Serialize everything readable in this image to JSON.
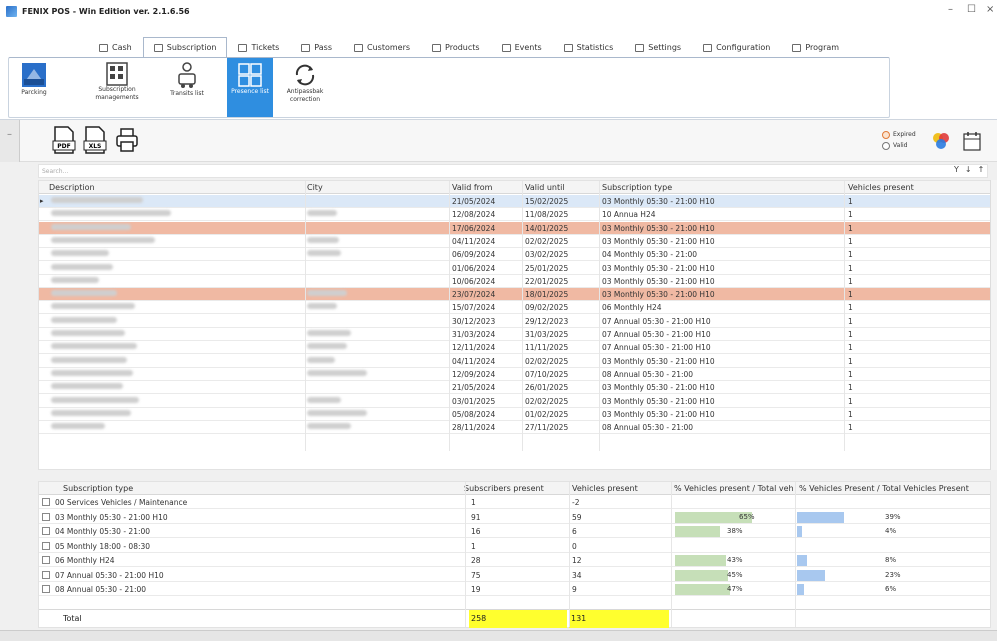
{
  "window": {
    "title": "FENIX POS - Win Edition ver. 2.1.6.56",
    "minimize": "–",
    "maximize": "☐",
    "close": "×"
  },
  "tabs": [
    {
      "label": "Cash",
      "active": false
    },
    {
      "label": "Subscription",
      "active": true
    },
    {
      "label": "Tickets",
      "active": false
    },
    {
      "label": "Pass",
      "active": false
    },
    {
      "label": "Customers",
      "active": false
    },
    {
      "label": "Products",
      "active": false
    },
    {
      "label": "Events",
      "active": false
    },
    {
      "label": "Statistics",
      "active": false
    },
    {
      "label": "Settings",
      "active": false
    },
    {
      "label": "Configuration",
      "active": false
    },
    {
      "label": "Program",
      "active": false
    }
  ],
  "ribbon": {
    "parking": "Parcking",
    "subscription_management": "Subscription managements",
    "transits_list": "Transits list",
    "presence_list": "Presence list",
    "antipassback": "Antipassbak correction"
  },
  "toolbar": {
    "pdf": "PDF",
    "xls": "XLS",
    "expired_label": "Expired",
    "valid_label": "Valid"
  },
  "search": {
    "placeholder": "Search..."
  },
  "grid": {
    "columns": [
      "Description",
      "City",
      "Valid from",
      "Valid until",
      "Subscription type",
      "Vehicles present"
    ],
    "rows": [
      {
        "from": "21/05/2024",
        "until": "15/02/2025",
        "type": "03 Monthly 05:30 - 21:00 H10",
        "vehicles": "1",
        "state": "selected",
        "city": false
      },
      {
        "from": "12/08/2024",
        "until": "11/08/2025",
        "type": "10 Annua H24",
        "vehicles": "1",
        "state": "",
        "city": true
      },
      {
        "from": "17/06/2024",
        "until": "14/01/2025",
        "type": "03 Monthly 05:30 - 21:00 H10",
        "vehicles": "1",
        "state": "expired",
        "city": false
      },
      {
        "from": "04/11/2024",
        "until": "02/02/2025",
        "type": "03 Monthly 05:30 - 21:00 H10",
        "vehicles": "1",
        "state": "",
        "city": true
      },
      {
        "from": "06/09/2024",
        "until": "03/02/2025",
        "type": "04 Monthly 05:30 - 21:00",
        "vehicles": "1",
        "state": "",
        "city": true
      },
      {
        "from": "01/06/2024",
        "until": "25/01/2025",
        "type": "03 Monthly 05:30 - 21:00 H10",
        "vehicles": "1",
        "state": "",
        "city": false
      },
      {
        "from": "10/06/2024",
        "until": "22/01/2025",
        "type": "03 Monthly 05:30 - 21:00 H10",
        "vehicles": "1",
        "state": "",
        "city": false
      },
      {
        "from": "23/07/2024",
        "until": "18/01/2025",
        "type": "03 Monthly 05:30 - 21:00 H10",
        "vehicles": "1",
        "state": "expired",
        "city": true
      },
      {
        "from": "15/07/2024",
        "until": "09/02/2025",
        "type": "06 Monthly H24",
        "vehicles": "1",
        "state": "",
        "city": true
      },
      {
        "from": "30/12/2023",
        "until": "29/12/2023",
        "type": "07 Annual 05:30 - 21:00 H10",
        "vehicles": "1",
        "state": "",
        "city": false
      },
      {
        "from": "31/03/2024",
        "until": "31/03/2025",
        "type": "07 Annual 05:30 - 21:00 H10",
        "vehicles": "1",
        "state": "",
        "city": true
      },
      {
        "from": "12/11/2024",
        "until": "11/11/2025",
        "type": "07 Annual 05:30 - 21:00 H10",
        "vehicles": "1",
        "state": "",
        "city": true
      },
      {
        "from": "04/11/2024",
        "until": "02/02/2025",
        "type": "03 Monthly 05:30 - 21:00 H10",
        "vehicles": "1",
        "state": "",
        "city": true
      },
      {
        "from": "12/09/2024",
        "until": "07/10/2025",
        "type": "08 Annual 05:30 - 21:00",
        "vehicles": "1",
        "state": "",
        "city": true
      },
      {
        "from": "21/05/2024",
        "until": "26/01/2025",
        "type": "03 Monthly 05:30 - 21:00 H10",
        "vehicles": "1",
        "state": "",
        "city": false
      },
      {
        "from": "03/01/2025",
        "until": "02/02/2025",
        "type": "03 Monthly 05:30 - 21:00 H10",
        "vehicles": "1",
        "state": "",
        "city": true
      },
      {
        "from": "05/08/2024",
        "until": "01/02/2025",
        "type": "03 Monthly 05:30 - 21:00 H10",
        "vehicles": "1",
        "state": "",
        "city": true
      },
      {
        "from": "28/11/2024",
        "until": "27/11/2025",
        "type": "08 Annual 05:30 - 21:00",
        "vehicles": "1",
        "state": "",
        "city": true
      }
    ]
  },
  "summary": {
    "columns": [
      "Subscription type",
      "Subscribers present",
      "Vehicles present",
      "% Vehicles present / Total veh",
      "% Vehicles Present / Total Vehicles Present"
    ],
    "rows": [
      {
        "type": "00 Services Vehicles / Maintenance",
        "subscribers": "1",
        "vehicles": "-2",
        "pct1": "",
        "pct1_val": 0,
        "pct2": "",
        "pct2_val": 0
      },
      {
        "type": "03 Monthly 05:30 - 21:00 H10",
        "subscribers": "91",
        "vehicles": "59",
        "pct1": "65%",
        "pct1_val": 65,
        "pct2": "39%",
        "pct2_val": 39
      },
      {
        "type": "04 Monthly 05:30 - 21:00",
        "subscribers": "16",
        "vehicles": "6",
        "pct1": "38%",
        "pct1_val": 38,
        "pct2": "4%",
        "pct2_val": 4
      },
      {
        "type": "05 Monthly 18:00 - 08:30",
        "subscribers": "1",
        "vehicles": "0",
        "pct1": "",
        "pct1_val": 0,
        "pct2": "",
        "pct2_val": 0
      },
      {
        "type": "06 Monthly H24",
        "subscribers": "28",
        "vehicles": "12",
        "pct1": "43%",
        "pct1_val": 43,
        "pct2": "8%",
        "pct2_val": 8
      },
      {
        "type": "07 Annual 05:30 - 21:00 H10",
        "subscribers": "75",
        "vehicles": "34",
        "pct1": "45%",
        "pct1_val": 45,
        "pct2": "23%",
        "pct2_val": 23
      },
      {
        "type": "08 Annual 05:30 - 21:00",
        "subscribers": "19",
        "vehicles": "9",
        "pct1": "47%",
        "pct1_val": 47,
        "pct2": "6%",
        "pct2_val": 6
      }
    ],
    "total_label": "Total",
    "total_subscribers": "258",
    "total_vehicles": "131"
  }
}
